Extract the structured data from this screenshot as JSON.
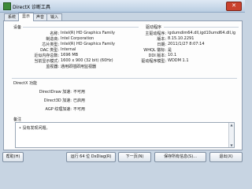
{
  "window": {
    "title": "DirectX 诊断工具",
    "close_glyph": "✕"
  },
  "tabs": [
    {
      "label": "系统"
    },
    {
      "label": "显示"
    },
    {
      "label": "声音"
    },
    {
      "label": "输入"
    }
  ],
  "device": {
    "heading": "设备",
    "rows": [
      {
        "label": "名称:",
        "value": "Intel(R) HD Graphics Family"
      },
      {
        "label": "制造商:",
        "value": "Intel Corporation"
      },
      {
        "label": "芯片类型:",
        "value": "Intel(R) HD Graphics Family"
      },
      {
        "label": "DAC 类型:",
        "value": "Internal"
      },
      {
        "label": "近似内存总数:",
        "value": "1696 MB"
      },
      {
        "label": "当前显示模式:",
        "value": "1600 x 900 (32 bit) (60Hz)"
      },
      {
        "label": "监视器:",
        "value": "通用即插即用监视器"
      }
    ]
  },
  "driver": {
    "heading": "驱动程序",
    "rows": [
      {
        "label": "主驱动程序:",
        "value": "igdumdim64.dll,igd10umd64.dll,ig"
      },
      {
        "label": "版本:",
        "value": "8.15.10.2291"
      },
      {
        "label": "日期:",
        "value": "2011/1/27 8:07:14"
      },
      {
        "label": "WHQL 徽标:",
        "value": "是"
      },
      {
        "label": "DDI 版本:",
        "value": "10.1"
      },
      {
        "label": "驱动程序模型:",
        "value": "WDDM 1.1"
      }
    ]
  },
  "directx": {
    "heading": "DirectX 功能",
    "rows": [
      {
        "label": "DirectDraw 加速:",
        "value": "不可用"
      },
      {
        "label": "Direct3D 加速:",
        "value": "已启用"
      },
      {
        "label": "AGP 纹理加速:",
        "value": "不可用"
      }
    ]
  },
  "notes": {
    "heading": "备注",
    "items": [
      "没有发现问题。"
    ]
  },
  "buttons": {
    "help": "帮助(H)",
    "run64": "运行 64 位 DxDiag(R)",
    "next": "下一页(N)",
    "save": "保存所有信息(S)...",
    "exit": "退出(X)"
  }
}
